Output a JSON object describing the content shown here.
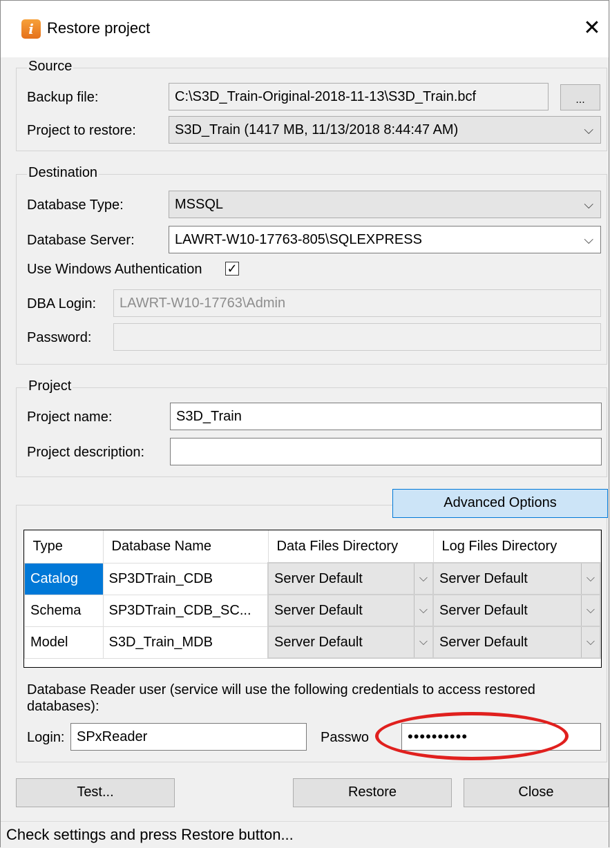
{
  "window": {
    "title": "Restore project",
    "close_glyph": "✕",
    "app_icon": "info-icon"
  },
  "source": {
    "group_label": "Source",
    "backup_file_label": "Backup file:",
    "backup_file_value": "C:\\S3D_Train-Original-2018-11-13\\S3D_Train.bcf",
    "browse_label": "...",
    "project_to_restore_label": "Project to restore:",
    "project_to_restore_value": "S3D_Train (1417 MB, 11/13/2018 8:44:47 AM)"
  },
  "destination": {
    "group_label": "Destination",
    "db_type_label": "Database Type:",
    "db_type_value": "MSSQL",
    "db_server_label": "Database Server:",
    "db_server_value": "LAWRT-W10-17763-805\\SQLEXPRESS",
    "windows_auth_label": "Use Windows Authentication",
    "windows_auth_checked": "✓",
    "dba_login_label": "DBA Login:",
    "dba_login_value": "LAWRT-W10-17763\\Admin",
    "password_label": "Password:"
  },
  "project": {
    "group_label": "Project",
    "name_label": "Project name:",
    "name_value": "S3D_Train",
    "description_label": "Project description:",
    "description_value": ""
  },
  "advanced": {
    "button_label": "Advanced Options",
    "columns": [
      "Type",
      "Database Name",
      "Data Files Directory",
      "Log Files Directory"
    ],
    "rows": [
      {
        "type": "Catalog",
        "name": "SP3DTrain_CDB",
        "data_dir": "Server Default",
        "log_dir": "Server Default"
      },
      {
        "type": "Schema",
        "name": "SP3DTrain_CDB_SC...",
        "data_dir": "Server Default",
        "log_dir": "Server Default"
      },
      {
        "type": "Model",
        "name": "S3D_Train_MDB",
        "data_dir": "Server Default",
        "log_dir": "Server Default"
      }
    ],
    "reader_note": "Database Reader user (service will use the following credentials to access restored databases):",
    "login_label": "Login:",
    "login_value": "SPxReader",
    "password_label": "Passwo",
    "password_value": "••••••••••"
  },
  "buttons": {
    "test": "Test...",
    "restore": "Restore",
    "close": "Close"
  },
  "status": {
    "text": "Check settings and press Restore button..."
  },
  "colors": {
    "selection": "#0078d7",
    "highlight_oval": "#e0201e",
    "advanced_button": "#cce4f7"
  }
}
